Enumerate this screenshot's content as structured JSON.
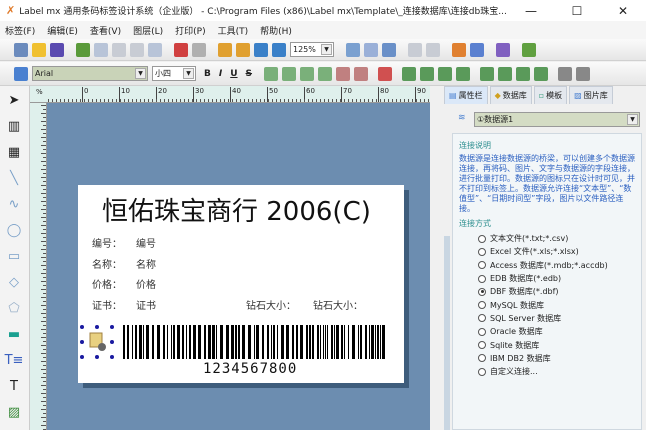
{
  "window": {
    "title": "Label mx 通用条码标签设计系统（企业版） - C:\\Program Files (x86)\\Label mx\\Template\\_连接数据库\\连接db珠宝...",
    "minimize": "—",
    "maximize": "☐",
    "close": "✕"
  },
  "menu": [
    "标签(F)",
    "编辑(E)",
    "查看(V)",
    "图层(L)",
    "打印(P)",
    "工具(T)",
    "帮助(H)"
  ],
  "toolbar": {
    "zoom": "125%",
    "font": "Arial",
    "font_size": "小四",
    "bold": "B",
    "italic": "I",
    "underline": "U",
    "strike": "S"
  },
  "ruler": {
    "h": [
      "0",
      "10",
      "20",
      "30",
      "40",
      "50",
      "60",
      "70",
      "80",
      "90"
    ],
    "unit": "%"
  },
  "label": {
    "title": "恒佑珠宝商行 2006(C)",
    "rows": [
      [
        "编号：",
        "编号"
      ],
      [
        "名称：",
        "名称"
      ],
      [
        "价格：",
        "价格"
      ],
      [
        "证书：",
        "证书"
      ]
    ],
    "diamond": [
      "钻石大小：",
      "钻石大小："
    ],
    "barcode": "1234567800"
  },
  "panel": {
    "tabs": [
      "属性栏",
      "数据库",
      "模板",
      "图片库"
    ],
    "datasource": "①数据源1",
    "desc_title": "连接说明",
    "desc": "数据源是连接数据源的桥梁，可以创建多个数据源连接，再将码、图片、文字与数据源的字段连接，进行批量打印。数据源的图标只在设计时可见，并不打印到标签上。数据源允许连接“文本型”、“数值型”、“日期时间型”字段，图片以文件路径连接。",
    "method_title": "连接方式",
    "options": [
      "文本文件(*.txt;*.csv)",
      "Excel 文件(*.xls;*.xlsx)",
      "Access 数据库(*.mdb;*.accdb)",
      "EDB 数据库(*.edb)",
      "DBF 数据库(*.dbf)",
      "MySQL 数据库",
      "SQL Server 数据库",
      "Oracle 数据库",
      "Sqlite 数据库",
      "IBM DB2 数据库",
      "自定义连接..."
    ],
    "selected_option": 4
  }
}
